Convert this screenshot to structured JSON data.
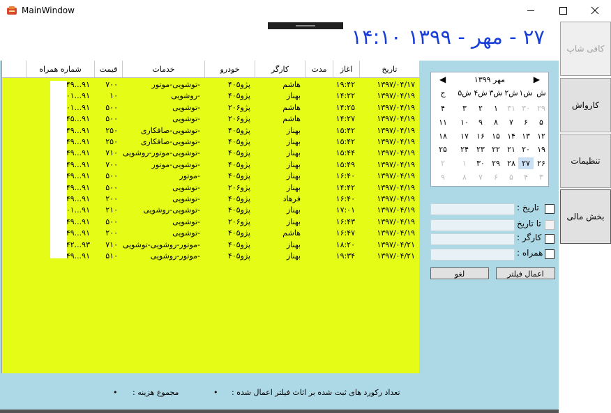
{
  "window": {
    "title": "MainWindow"
  },
  "header": {
    "clock": "۲۷ - مهر - ۱۳۹۹  ۱۴:۱۰"
  },
  "sidebar": {
    "items": [
      {
        "label": "کافی شاپ",
        "state": "disabled"
      },
      {
        "label": "کارواش",
        "state": "normal"
      },
      {
        "label": "تنظیمات",
        "state": "normal"
      },
      {
        "label": "بخش مالی",
        "state": "active"
      }
    ]
  },
  "table": {
    "headers": [
      "تاریخ",
      "اغاز",
      "مدت",
      "کارگر",
      "خودرو",
      "خدمات",
      "قیمت",
      "شماره همراه"
    ],
    "rows": [
      [
        "۱۳۹۷/۰۴/۱۷",
        "۱۹:۴۲",
        "",
        "هاشم",
        "پژو۴۰۵",
        "-توشویی-موتور",
        "۷۰۰",
        "۹۱...۴۹"
      ],
      [
        "۱۳۹۷/۰۴/۱۹",
        "۱۴:۲۲",
        "",
        "بهناز",
        "پژو۴۰۵",
        "-روشویی",
        "۱۰",
        "۹۱...۰۱"
      ],
      [
        "۱۳۹۷/۰۴/۱۹",
        "۱۴:۲۵",
        "",
        "هاشم",
        "پژو۲۰۶",
        "-توشویی",
        "۵۰۰",
        "۹۱...۰۱"
      ],
      [
        "۱۳۹۷/۰۴/۱۹",
        "۱۴:۲۷",
        "",
        "هاشم",
        "پژو۲۰۶",
        "-توشویی",
        "۵۰۰",
        "۹۱...۴۵"
      ],
      [
        "۱۳۹۷/۰۴/۱۹",
        "۱۵:۴۲",
        "",
        "بهناز",
        "پژو۴۰۵",
        "-توشویی-صافکاری",
        "۲۵۰",
        "۹۱...۴۹"
      ],
      [
        "۱۳۹۷/۰۴/۱۹",
        "۱۵:۴۲",
        "",
        "بهناز",
        "پژو۴۰۵",
        "-توشویی-صافکاری",
        "۲۵۰",
        "۹۱...۴۹"
      ],
      [
        "۱۳۹۷/۰۴/۱۹",
        "۱۵:۴۴",
        "",
        "بهناز",
        "پژو۴۰۵",
        "-توشویی-موتور-روشویی",
        "۷۱۰",
        "۹۱...۴۹"
      ],
      [
        "۱۳۹۷/۰۴/۱۹",
        "۱۵:۴۹",
        "",
        "بهناز",
        "پژو۴۰۵",
        "-توشویی-موتور",
        "۷۰۰",
        "۹۱...۴۹"
      ],
      [
        "۱۳۹۷/۰۴/۱۹",
        "۱۶:۴۰",
        "",
        "بهناز",
        "پژو۴۰۵",
        "-موتور",
        "۵۰۰",
        "۹۱...۴۹"
      ],
      [
        "۱۳۹۷/۰۴/۱۹",
        "۱۴:۴۲",
        "",
        "بهناز",
        "پژو۲۰۶",
        "-توشویی",
        "۵۰۰",
        "۹۱...۴۹"
      ],
      [
        "۱۳۹۷/۰۴/۱۹",
        "۱۶:۴۰",
        "",
        "فرهاد",
        "پژو۴۰۵",
        "-توشویی",
        "۲۰۰",
        "۹۱...۴۹"
      ],
      [
        "۱۳۹۷/۰۴/۱۹",
        "۱۷:۰۱",
        "",
        "بهناز",
        "پژو۴۰۵",
        "-توشویی-روشویی",
        "۲۱۰",
        "۹۱...۰۱"
      ],
      [
        "۱۳۹۷/۰۴/۱۹",
        "۱۶:۴۳",
        "",
        "بهناز",
        "پژو۲۰۶",
        "-توشویی",
        "۵۰۰",
        "۹۱...۴۹"
      ],
      [
        "۱۳۹۷/۰۴/۱۹",
        "۱۶:۴۷",
        "",
        "هاشم",
        "پژو۴۰۵",
        "-توشویی",
        "۲۰۰",
        "۹۱...۴۹"
      ],
      [
        "۱۳۹۷/۰۴/۲۱",
        "۱۸:۲۰",
        "",
        "بهناز",
        "پژو۴۰۵",
        "-موتور-روشویی-توشویی",
        "۷۱۰",
        "۹۳...۴۲"
      ],
      [
        "۱۳۹۷/۰۴/۲۱",
        "۱۹:۳۴",
        "",
        "بهناز",
        "پژو۴۰۵",
        "-موتور-روشویی",
        "۵۱۰",
        "۹۱...۴۹"
      ]
    ]
  },
  "calendar": {
    "month_label": "مهر ۱۳۹۹",
    "weekdays": [
      "ش",
      "۱ش",
      "۲ش",
      "۳ش",
      "۴ش",
      "۵ش",
      "ج"
    ],
    "weeks": [
      [
        "۲۹",
        "۳۰",
        "۳۱",
        "۱",
        "۲",
        "۳",
        "۴"
      ],
      [
        "۵",
        "۶",
        "۷",
        "۸",
        "۹",
        "۱۰",
        "۱۱"
      ],
      [
        "۱۲",
        "۱۳",
        "۱۴",
        "۱۵",
        "۱۶",
        "۱۷",
        "۱۸"
      ],
      [
        "۱۹",
        "۲۰",
        "۲۱",
        "۲۲",
        "۲۳",
        "۲۴",
        "۲۵"
      ],
      [
        "۲۶",
        "۲۷",
        "۲۸",
        "۲۹",
        "۳۰",
        "۱",
        "۲"
      ],
      [
        "۳",
        "۴",
        "۵",
        "۶",
        "۷",
        "۸",
        "۹"
      ]
    ],
    "selected": "۲۷"
  },
  "filters": {
    "date_label": "تاریخ :",
    "to_date_label": "تا تاریخ",
    "worker_label": "کارگر :",
    "phone_label": "همراه :",
    "apply_label": "اعمال فیلتر",
    "cancel_label": "لغو"
  },
  "status": {
    "records_text": "تعداد رکورد های ثبت شده بر اثاث فیلتر اعمال شده :",
    "records_value": "•",
    "cost_text": "مجموع هزینه :",
    "cost_value": "•"
  }
}
